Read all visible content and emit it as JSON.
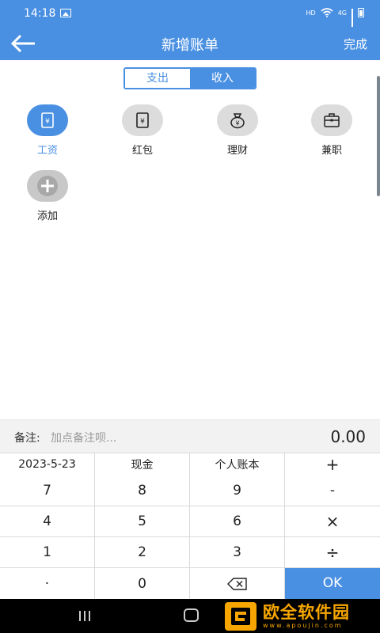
{
  "status": {
    "time": "14:18",
    "network_hd": "HD",
    "network_4g": "4G"
  },
  "header": {
    "title": "新增账单",
    "done": "完成"
  },
  "tabs": {
    "expense": "支出",
    "income": "收入"
  },
  "categories": [
    {
      "label": "工资",
      "icon": "payroll-icon"
    },
    {
      "label": "红包",
      "icon": "red-envelope-icon"
    },
    {
      "label": "理财",
      "icon": "money-bag-icon"
    },
    {
      "label": "兼职",
      "icon": "briefcase-icon"
    },
    {
      "label": "添加",
      "icon": "add-icon"
    }
  ],
  "note": {
    "label": "备注:",
    "placeholder": "加点备注呗...",
    "amount": "0.00"
  },
  "keypad": {
    "row0": [
      "2023-5-23",
      "现金",
      "个人账本",
      "+"
    ],
    "row1": [
      "7",
      "8",
      "9",
      "-"
    ],
    "row2": [
      "4",
      "5",
      "6",
      "×"
    ],
    "row3": [
      "1",
      "2",
      "3",
      "÷"
    ],
    "row4": [
      "·",
      "0",
      "",
      "OK"
    ]
  },
  "watermark": {
    "name": "欧全软件园",
    "url": "www.apoujin.com"
  },
  "colors": {
    "accent": "#4a90e2",
    "watermark": "#f7a600"
  }
}
